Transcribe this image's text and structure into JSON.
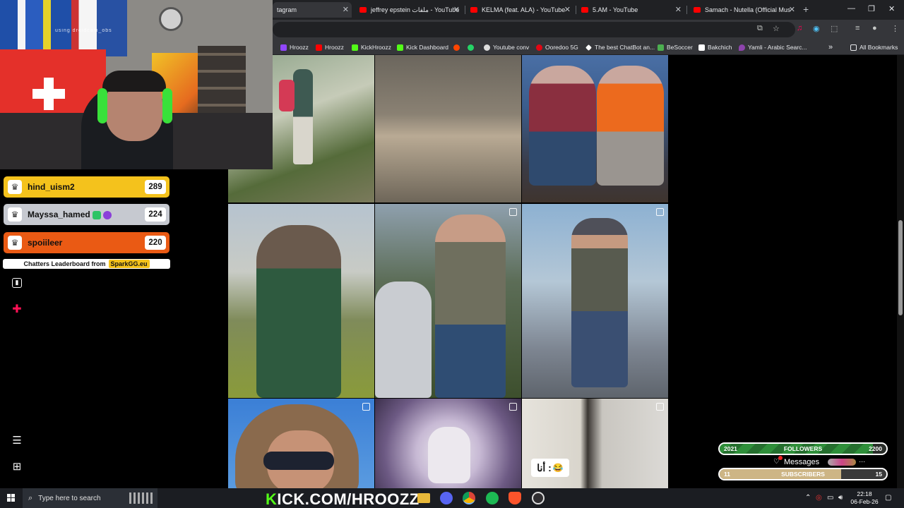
{
  "browser": {
    "tabs": [
      {
        "label": "tagram",
        "active": true
      },
      {
        "label": "jeffrey epstein ملفات - YouTube"
      },
      {
        "label": "KELMA (feat. ALA) - YouTube"
      },
      {
        "label": "5.AM - YouTube"
      },
      {
        "label": "Samach - Nutella (Official Mus"
      }
    ],
    "bookmarks": [
      {
        "label": "Hroozz",
        "color": "#9146ff"
      },
      {
        "label": "Hroozz",
        "color": "#ff0000"
      },
      {
        "label": "KickHroozz",
        "color": "#53fc18"
      },
      {
        "label": "Kick Dashboard",
        "color": "#53fc18"
      },
      {
        "label": "Youtube conv",
        "color": "#ffffff"
      },
      {
        "label": "Ooredoo 5G",
        "color": "#e30613"
      },
      {
        "label": "The best ChatBot an...",
        "color": "#ffffff"
      },
      {
        "label": "BeSoccer",
        "color": "#4caf50"
      },
      {
        "label": "Bakchich",
        "color": "#ffffff"
      },
      {
        "label": "Yamli - Arabic Searc...",
        "color": "#8e44ad"
      }
    ],
    "all_bookmarks": "All Bookmarks"
  },
  "webcam": {
    "watermark": "using droidcam_obs"
  },
  "leaderboard": {
    "rows": [
      {
        "name": "hind_uism2",
        "value": "289",
        "color": "#f4c21c"
      },
      {
        "name": "Mayssa_hamed",
        "value": "224",
        "color": "#c6c9d0"
      },
      {
        "name": "spoiileer",
        "value": "220",
        "color": "#ea5a14"
      }
    ],
    "footer_text": "Chatters Leaderboard from",
    "footer_brand": "SparkGG.eu"
  },
  "post_overlay_text": "أنا :",
  "stream_overlay": {
    "followers": {
      "current": "2021",
      "label": "FOLLOWERS",
      "goal": "2200",
      "progress": 0.92
    },
    "messages_label": "Messages",
    "subscribers": {
      "current": "11",
      "label": "SUBSCRIBERS",
      "goal": "15",
      "progress": 0.73
    }
  },
  "taskbar": {
    "search_placeholder": "Type here to search",
    "kick_prefix": "K",
    "kick_rest": "ICK.COM/HROOZZ",
    "time": "22:18",
    "date": "06-Feb-26"
  }
}
